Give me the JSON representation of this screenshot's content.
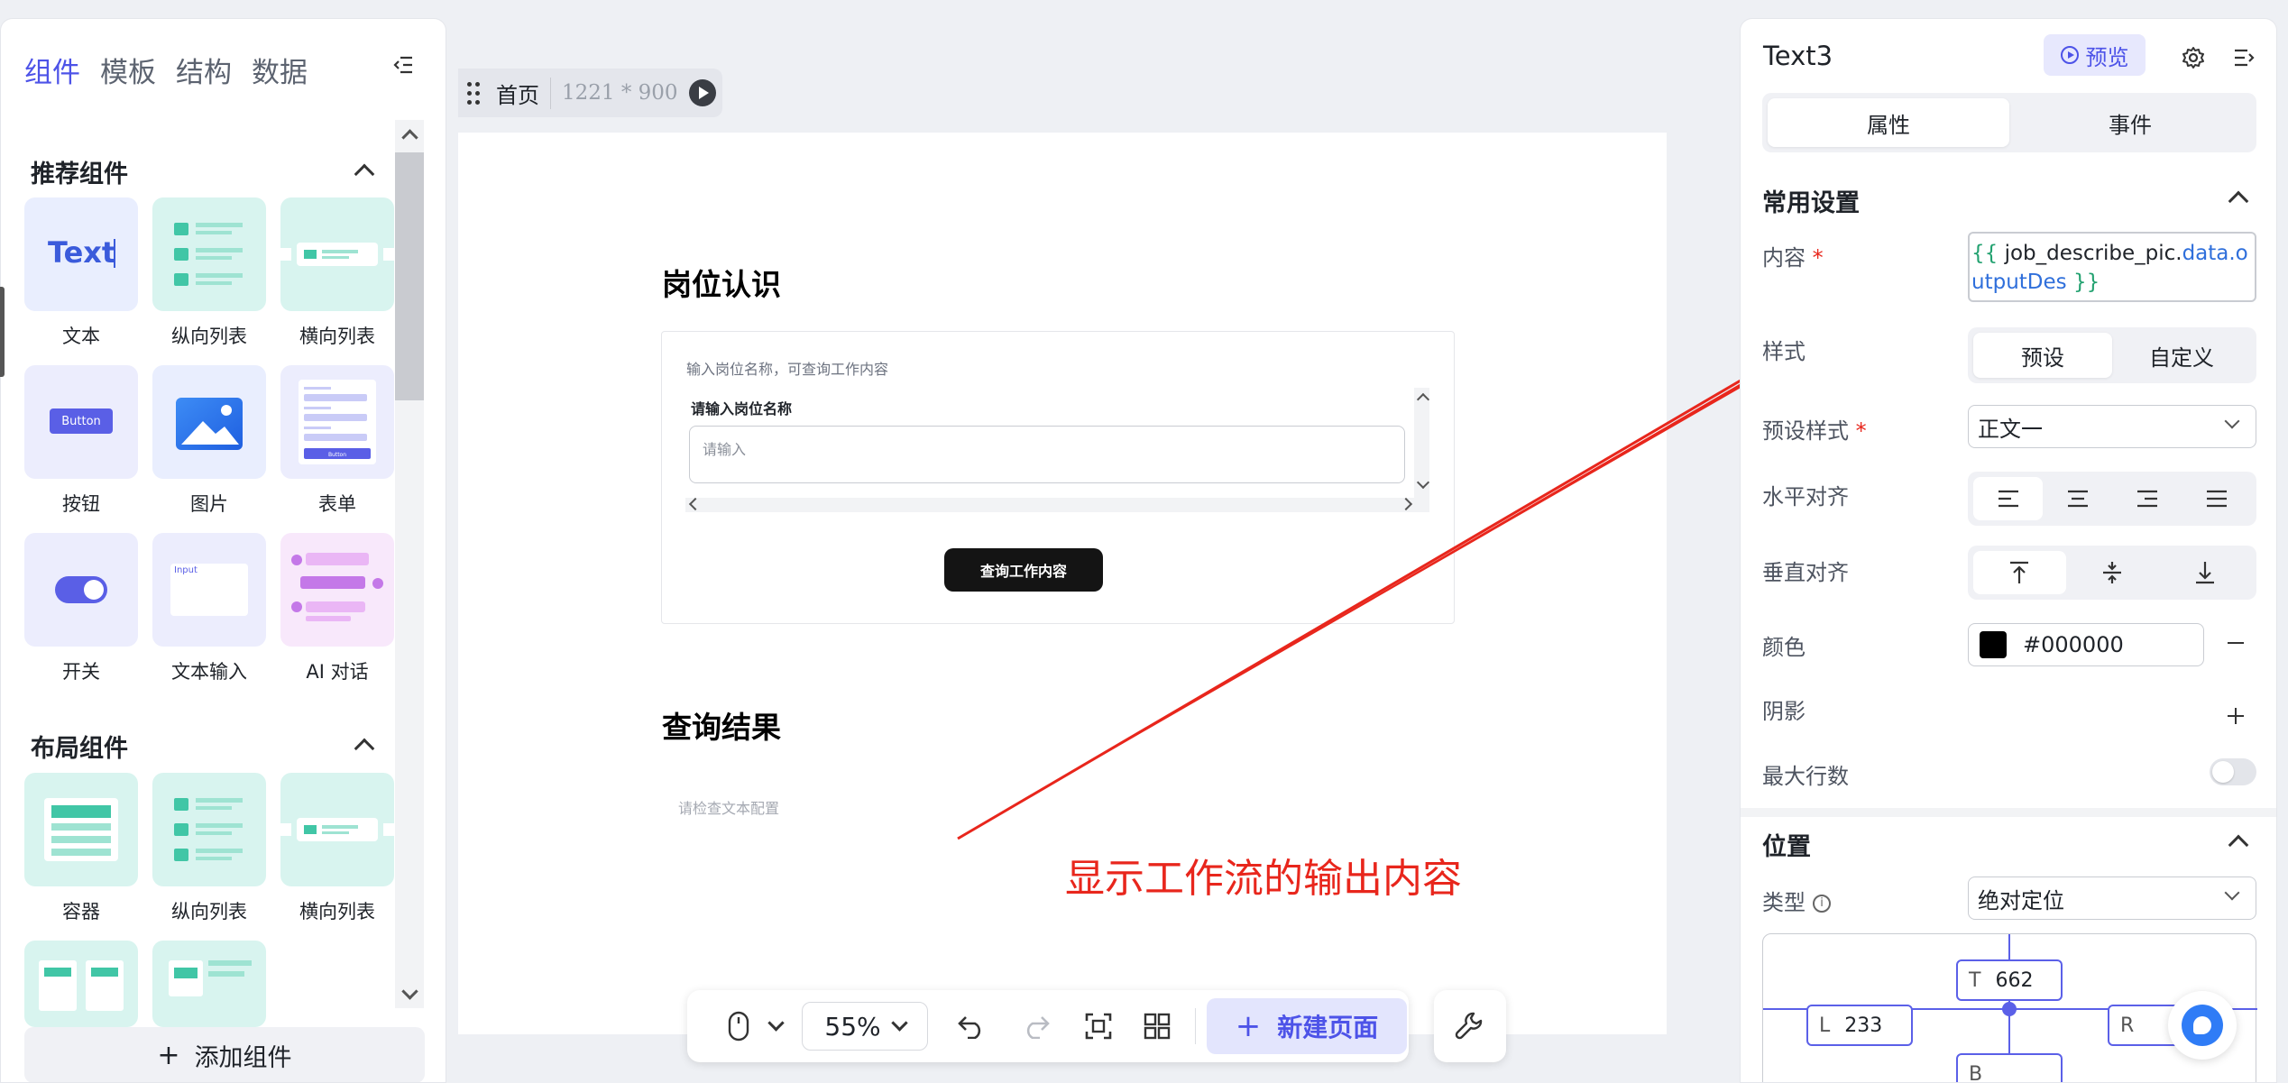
{
  "left_panel": {
    "tabs": [
      "组件",
      "模板",
      "结构",
      "数据"
    ],
    "active_tab": "组件",
    "sections": {
      "recommended": "推荐组件",
      "layout": "布局组件"
    },
    "recommended_items": [
      {
        "label": "文本",
        "icon": "text-component-icon",
        "thumb_text": "Text"
      },
      {
        "label": "纵向列表",
        "icon": "vertical-list-icon"
      },
      {
        "label": "横向列表",
        "icon": "horizontal-list-icon"
      },
      {
        "label": "按钮",
        "icon": "button-component-icon",
        "thumb_text": "Button"
      },
      {
        "label": "图片",
        "icon": "image-component-icon"
      },
      {
        "label": "表单",
        "icon": "form-component-icon",
        "thumb_text": "Button"
      },
      {
        "label": "开关",
        "icon": "switch-component-icon"
      },
      {
        "label": "文本输入",
        "icon": "text-input-icon",
        "thumb_text": "Input"
      },
      {
        "label": "AI 对话",
        "icon": "ai-chat-icon"
      }
    ],
    "layout_items": [
      {
        "label": "容器",
        "icon": "container-icon"
      },
      {
        "label": "纵向列表",
        "icon": "vertical-list-icon"
      },
      {
        "label": "横向列表",
        "icon": "horizontal-list-icon"
      }
    ],
    "add_component": "添加组件"
  },
  "canvas": {
    "page_name": "首页",
    "page_size": "1221 * 900",
    "title1": "岗位认识",
    "form_hint": "输入岗位名称，可查询工作内容",
    "input_label": "请输入岗位名称",
    "input_placeholder": "请输入",
    "query_button": "查询工作内容",
    "title2": "查询结果",
    "result_placeholder": "请检查文本配置",
    "annotation": "显示工作流的输出内容"
  },
  "toolbar": {
    "zoom": "55%",
    "new_page": "新建页面"
  },
  "right_panel": {
    "title": "Text3",
    "preview": "预览",
    "tabs": [
      "属性",
      "事件"
    ],
    "active_tab": "属性",
    "common_section": "常用设置",
    "content_label": "内容",
    "content_value": {
      "open": "{{ ",
      "id": "job_describe_pic.",
      "prop": "data.outputDes",
      "close": " }}"
    },
    "style_label": "样式",
    "style_options": [
      "预设",
      "自定义"
    ],
    "style_active": "预设",
    "preset_style_label": "预设样式",
    "preset_style_value": "正文一",
    "h_align_label": "水平对齐",
    "v_align_label": "垂直对齐",
    "color_label": "颜色",
    "color_value": "#000000",
    "shadow_label": "阴影",
    "max_lines_label": "最大行数",
    "max_lines_enabled": false,
    "position_section": "位置",
    "type_label": "类型",
    "type_value": "绝对定位",
    "pos": {
      "T": "662",
      "L": "233",
      "R": "",
      "B": ""
    }
  },
  "colors": {
    "accent": "#4d53e8",
    "annotation_red": "#e8261c",
    "brace_green": "#21a16f",
    "prop_blue": "#2f6fdb"
  }
}
